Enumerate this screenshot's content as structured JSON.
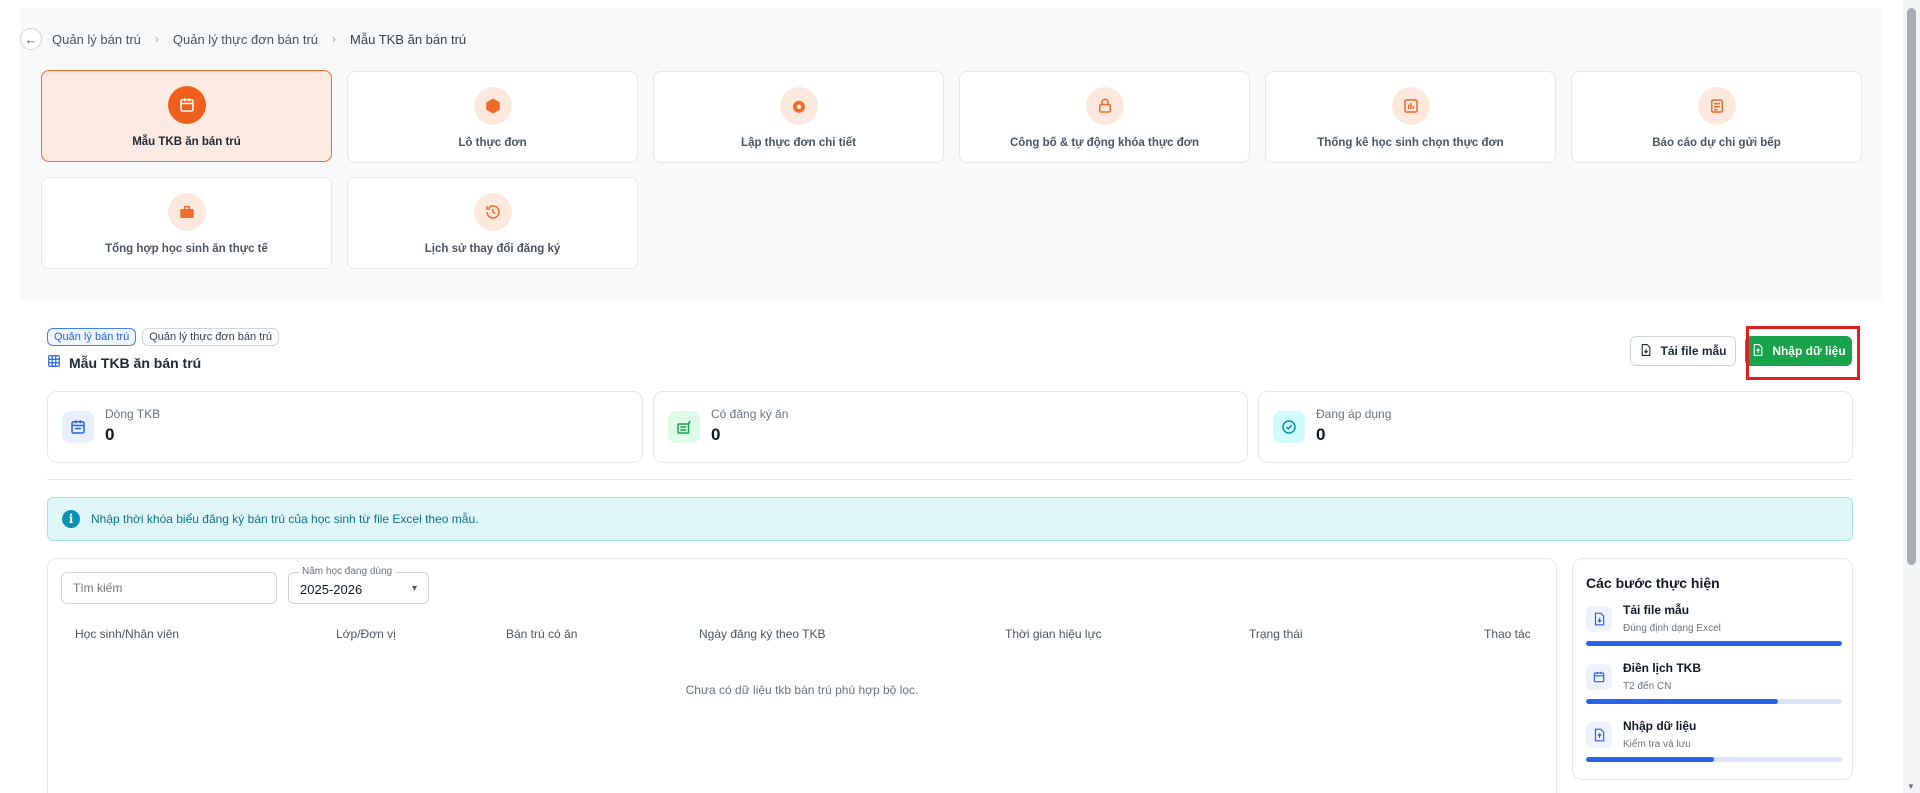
{
  "breadcrumb": {
    "items": [
      "Quản lý bán trú",
      "Quản lý thực đơn bán trú",
      "Mẫu TKB ăn bán trú"
    ],
    "separator": "›"
  },
  "modules": [
    {
      "label": "Mẫu TKB ăn bán trú",
      "icon": "calendar-icon",
      "active": true
    },
    {
      "label": "Lô thực đơn",
      "icon": "box-icon",
      "active": false
    },
    {
      "label": "Lập thực đơn chi tiết",
      "icon": "food-icon",
      "active": false
    },
    {
      "label": "Công bố & tự động khóa thực đơn",
      "icon": "lock-icon",
      "active": false
    },
    {
      "label": "Thống kê học sinh chọn thực đơn",
      "icon": "bar-chart-icon",
      "active": false
    },
    {
      "label": "Báo cáo dự chi gửi bếp",
      "icon": "document-icon",
      "active": false
    },
    {
      "label": "Tổng hợp học sinh ăn thực tế",
      "icon": "briefcase-icon",
      "active": false
    },
    {
      "label": "Lịch sử thay đổi đăng ký",
      "icon": "history-icon",
      "active": false
    }
  ],
  "section": {
    "tags": [
      "Quản lý bán trú",
      "Quản lý thực đơn bán trú"
    ],
    "title": "Mẫu TKB ăn bán trú",
    "download_label": "Tải file mẫu",
    "import_label": "Nhập dữ liệu"
  },
  "stats": [
    {
      "label": "Dòng TKB",
      "value": "0",
      "icon": "calendar-icon",
      "color": "#2563eb"
    },
    {
      "label": "Có đăng ký ăn",
      "value": "0",
      "icon": "meal-icon",
      "color": "#16a34a"
    },
    {
      "label": "Đang áp dụng",
      "value": "0",
      "icon": "check-circle-icon",
      "color": "#0891b2"
    }
  ],
  "info_message": "Nhập thời khóa biểu đăng ký bán trú của học sinh từ file Excel theo mẫu.",
  "filters": {
    "search_placeholder": "Tìm kiếm",
    "year_label": "Năm học đang dùng",
    "year_value": "2025-2026"
  },
  "table": {
    "columns": [
      "Học sinh/Nhân viên",
      "Lớp/Đơn vị",
      "Bán trú có ăn",
      "Ngày đăng ký theo TKB",
      "Thời gian hiệu lực",
      "Trạng thái",
      "Thao tác"
    ],
    "empty_text": "Chưa có dữ liệu tkb bán trú phù hợp bộ lọc."
  },
  "steps": {
    "title": "Các bước thực hiện",
    "items": [
      {
        "title": "Tải file mẫu",
        "subtitle": "Đúng định dạng Excel",
        "progress": 1.0
      },
      {
        "title": "Điền lịch TKB",
        "subtitle": "T2 đến CN",
        "progress": 0.75
      },
      {
        "title": "Nhập dữ liệu",
        "subtitle": "Kiểm tra và lưu",
        "progress": 0.5
      }
    ]
  },
  "colors": {
    "accent": "#ef5f1e",
    "primary_button": "#16a34a",
    "highlight": "#e11d1d",
    "progress": "#2563eb"
  }
}
